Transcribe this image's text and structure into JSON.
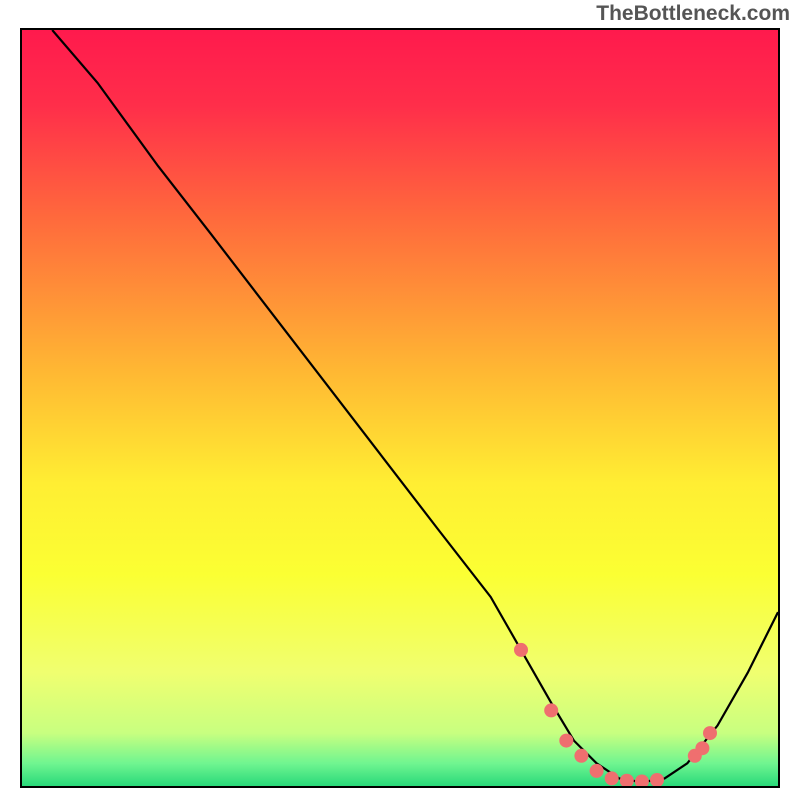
{
  "watermark": "TheBottleneck.com",
  "chart_data": {
    "type": "line",
    "title": "",
    "xlabel": "",
    "ylabel": "",
    "xlim": [
      0,
      100
    ],
    "ylim": [
      0,
      100
    ],
    "gradient_stops": [
      {
        "offset": 0.0,
        "color": "#ff1a4d"
      },
      {
        "offset": 0.1,
        "color": "#ff2e4a"
      },
      {
        "offset": 0.25,
        "color": "#ff6a3c"
      },
      {
        "offset": 0.45,
        "color": "#ffb733"
      },
      {
        "offset": 0.6,
        "color": "#ffee33"
      },
      {
        "offset": 0.72,
        "color": "#fbff33"
      },
      {
        "offset": 0.85,
        "color": "#f0ff70"
      },
      {
        "offset": 0.93,
        "color": "#c8ff80"
      },
      {
        "offset": 0.97,
        "color": "#70f590"
      },
      {
        "offset": 1.0,
        "color": "#29d97a"
      }
    ],
    "series": [
      {
        "name": "curve",
        "x": [
          4,
          10,
          18,
          25,
          35,
          45,
          55,
          62,
          66,
          70,
          73,
          76,
          79,
          82,
          85,
          88,
          92,
          96,
          100
        ],
        "y": [
          100,
          93,
          82,
          73,
          60,
          47,
          34,
          25,
          18,
          11,
          6,
          3,
          1,
          0.5,
          1,
          3,
          8,
          15,
          23
        ]
      }
    ],
    "markers": {
      "name": "dots",
      "color": "#ef6f6f",
      "x": [
        66,
        70,
        72,
        74,
        76,
        78,
        80,
        82,
        84,
        89,
        90,
        91
      ],
      "y": [
        18,
        10,
        6,
        4,
        2,
        1,
        0.7,
        0.6,
        0.8,
        4,
        5,
        7
      ]
    }
  }
}
